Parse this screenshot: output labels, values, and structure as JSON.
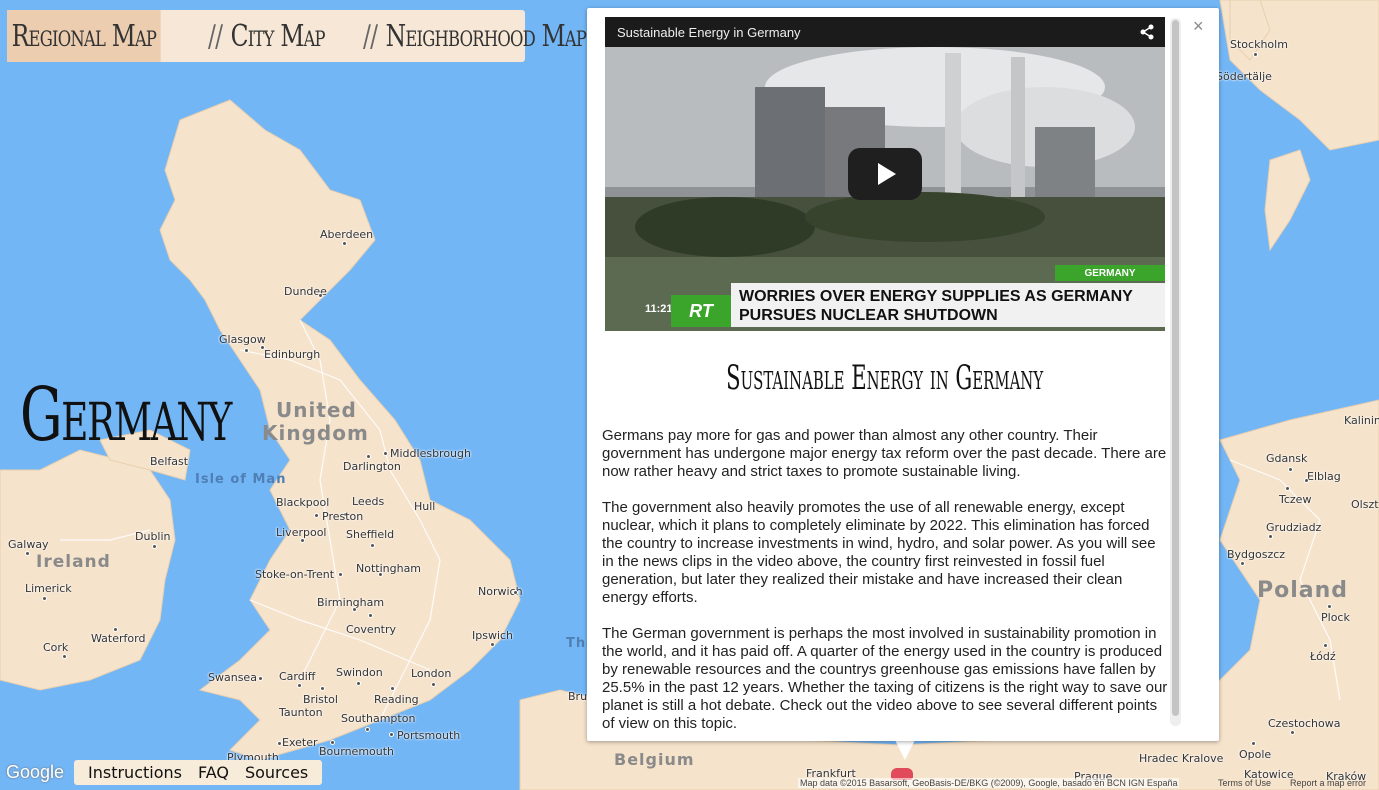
{
  "nav": {
    "tabs": [
      {
        "label": "Regional Map",
        "active": true
      },
      {
        "label": "City Map",
        "active": false
      },
      {
        "label": "Neighborhood Map",
        "active": false
      }
    ],
    "separator": "//"
  },
  "map": {
    "title": "Germany",
    "countries": [
      "United",
      "Kingdom",
      "Ireland",
      "Poland",
      "Belgium"
    ],
    "sea": [
      "Isle of Man",
      "The"
    ],
    "cities": [
      "Aberdeen",
      "Dundee",
      "Glasgow",
      "Edinburgh",
      "Belfast",
      "Middlesbrough",
      "Darlington",
      "Blackpool",
      "Leeds",
      "Preston",
      "Hull",
      "Liverpool",
      "Sheffield",
      "Dublin",
      "Galway",
      "Limerick",
      "Nottingham",
      "Stoke-on-Trent",
      "Norwich",
      "Birmingham",
      "Coventry",
      "Ipswich",
      "Waterford",
      "Cork",
      "Swindon",
      "London",
      "Cardiff",
      "Swansea",
      "Bristol",
      "Reading",
      "Taunton",
      "Southampton",
      "Exeter",
      "Portsmouth",
      "Bournemouth",
      "Plymouth",
      "Stockholm",
      "Södertälje",
      "Gdansk",
      "Elblag",
      "Tczew",
      "Grudziadz",
      "Bydgoszcz",
      "Plock",
      "Łódź",
      "Czestochowa",
      "Opole",
      "Katowice",
      "Frankfurt",
      "Hradec Kralove",
      "Prague",
      "Kalinin",
      "Olszt",
      "Bru",
      "Kraków"
    ],
    "google_logo": "Google",
    "attribution": "Map data ©2015 Basarsoft, GeoBasis-DE/BKG (©2009), Google, basado en BCN IGN España",
    "terms": "Terms of Use",
    "report": "Report a map error",
    "marker_color": "#e04a5a",
    "water_color": "#73b6f6",
    "land_color": "#f5e3cc"
  },
  "bottom_bar": {
    "instructions": "Instructions",
    "faq": "FAQ",
    "sources": "Sources"
  },
  "popup": {
    "close_icon": "×",
    "video": {
      "title": "Sustainable Energy in Germany",
      "share_icon": "share-icon",
      "chyron_tag": "GERMANY",
      "chyron_logo": "RT",
      "chyron_time": "11:21",
      "chyron_headline": "Worries over energy supplies as Germany pursues nuclear shutdown"
    },
    "title": "Sustainable Energy in Germany",
    "paragraphs": [
      "Germans pay more for gas and power than almost any other country. Their government has undergone major energy tax reform over the past decade. There are now rather heavy and strict taxes to promote sustainable living.",
      "The government also heavily promotes the use of all renewable energy, except nuclear, which it plans to completely eliminate by 2022. This elimination has forced the country to increase investments in wind, hydro, and solar power. As you will see in the news clips in the video above, the country first reinvested in fossil fuel generation, but later they realized their mistake and have increased their clean energy efforts.",
      "The German government is perhaps the most involved in sustainability promotion in the world, and it has paid off. A quarter of the energy used in the country is produced by renewable resources and the countrys greenhouse gas emissions have fallen by 25.5% in the past 12 years. Whether the taxing of citizens is the right way to save our planet is still a hot debate. Check out the video above to see several different points of view on this topic."
    ]
  }
}
